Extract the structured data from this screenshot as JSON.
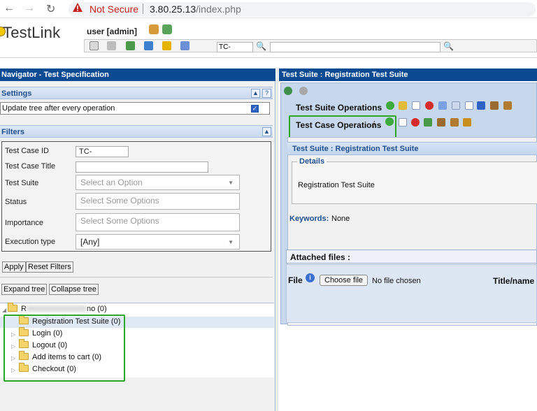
{
  "browser": {
    "not_secure": "Not Secure",
    "url_host": "3.80.25.13",
    "url_path": "/index.php"
  },
  "header": {
    "logo_text": "TestLink",
    "user_label": "user [admin]",
    "tc_prefix": "TC-"
  },
  "navigator": {
    "title": "Navigator - Test Specification",
    "settings_title": "Settings",
    "update_tree_label": "Update tree after every operation",
    "update_tree_checked": true,
    "filters_title": "Filters",
    "filters": {
      "test_case_id_label": "Test Case ID",
      "test_case_id_value": "TC-",
      "test_case_title_label": "Test Case Title",
      "test_case_title_value": "",
      "test_suite_label": "Test Suite",
      "test_suite_placeholder": "Select an Option",
      "status_label": "Status",
      "status_placeholder": "Select Some Options",
      "importance_label": "Importance",
      "importance_placeholder": "Select Some Options",
      "execution_type_label": "Execution type",
      "execution_type_value": "[Any]"
    },
    "apply_label": "Apply",
    "reset_filters_label": "Reset Filters",
    "expand_tree_label": "Expand tree",
    "collapse_tree_label": "Collapse tree",
    "tree": {
      "root_prefix": "R",
      "root_suffix": "no (0)",
      "children": [
        {
          "label": "Registration Test Suite (0)",
          "selected": true
        },
        {
          "label": "Login (0)"
        },
        {
          "label": "Logout (0)"
        },
        {
          "label": "Add items to cart (0)"
        },
        {
          "label": "Checkout (0)"
        }
      ]
    }
  },
  "right_panel": {
    "title": "Test Suite : Registration Test Suite",
    "test_suite_operations": "Test Suite Operations",
    "test_case_operations": "Test Case Operations",
    "suite_header": "Test Suite : Registration Test Suite",
    "details_legend": "Details",
    "details_text": "Registration Test Suite",
    "keywords_label": "Keywords:",
    "keywords_value": "None",
    "attached_files_label": "Attached files :",
    "file_label": "File",
    "choose_file_label": "Choose file",
    "no_file_label": "No file chosen",
    "title_name_label": "Title/name"
  },
  "colors": {
    "title_bar": "#0c4a93",
    "highlight_box": "#2aa82a",
    "not_secure": "#c5221f"
  }
}
